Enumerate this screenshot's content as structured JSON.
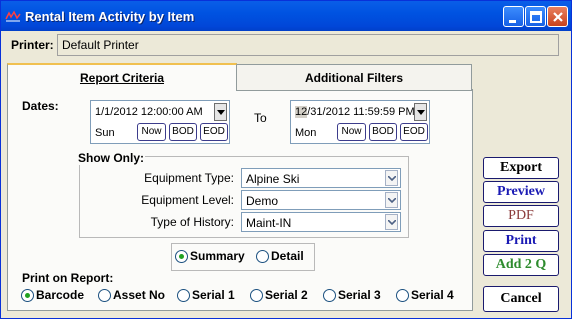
{
  "window": {
    "title": "Rental Item Activity by Item"
  },
  "printer": {
    "label": "Printer:",
    "value": "Default Printer"
  },
  "tabs": [
    {
      "label": "Report Criteria",
      "active": true
    },
    {
      "label": "Additional Filters",
      "active": false
    }
  ],
  "dates": {
    "label": "Dates:",
    "to_label": "To",
    "from": {
      "value": "1/1/2012 12:00:00 AM",
      "day": "Sun"
    },
    "to": {
      "value_highlight": "12",
      "value_rest": "/31/2012 11:59:59 PM",
      "day": "Mon"
    },
    "buttons": [
      "Now",
      "BOD",
      "EOD"
    ]
  },
  "show_only": {
    "title": "Show Only:",
    "equipment_type": {
      "label": "Equipment Type:",
      "value": "Alpine Ski"
    },
    "equipment_level": {
      "label": "Equipment Level:",
      "value": "Demo"
    },
    "type_of_history": {
      "label": "Type of History:",
      "value": "Maint-IN"
    }
  },
  "mode": {
    "options": [
      "Summary",
      "Detail"
    ],
    "selected": "Summary"
  },
  "print_on_report": {
    "label": "Print on Report:",
    "options": [
      "Barcode",
      "Asset No",
      "Serial 1",
      "Serial 2",
      "Serial 3",
      "Serial 4"
    ],
    "selected": "Barcode"
  },
  "actions": {
    "export": "Export",
    "preview": "Preview",
    "pdf": "PDF",
    "print": "Print",
    "add2q": "Add 2 Q",
    "cancel": "Cancel"
  },
  "colors": {
    "titlebar": "#0053e1",
    "export": "#000000",
    "preview": "#1a1ab4",
    "pdf": "#8b3a3a",
    "print": "#1a1ab4",
    "add2q": "#2e8b2e",
    "cancel": "#000000",
    "radio_dot": "#21a121"
  }
}
